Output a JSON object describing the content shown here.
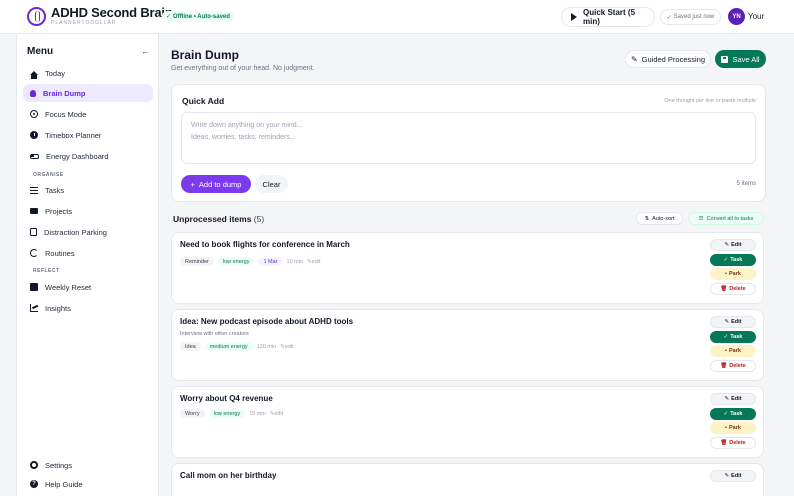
{
  "header": {
    "brand_title": "ADHD Second Brain",
    "brand_subtitle": "PLANNERTODOLLAR",
    "offline_badge": "Offline • Auto-saved",
    "quick_start_label": "Quick Start (5 min)",
    "saved_status": "Saved just now",
    "avatar_initials": "YN",
    "user_label": "Your"
  },
  "sidebar": {
    "title": "Menu",
    "items": [
      {
        "label": "Today",
        "icon": "home-icon"
      },
      {
        "label": "Brain Dump",
        "icon": "lightbulb-icon",
        "active": true
      },
      {
        "label": "Focus Mode",
        "icon": "target-icon"
      },
      {
        "label": "Timebox Planner",
        "icon": "clock-icon"
      },
      {
        "label": "Energy Dashboard",
        "icon": "battery-icon"
      }
    ],
    "section_organise": "ORGANISE",
    "organise_items": [
      {
        "label": "Tasks",
        "icon": "list-icon"
      },
      {
        "label": "Projects",
        "icon": "folder-icon"
      },
      {
        "label": "Distraction Parking",
        "icon": "page-icon"
      },
      {
        "label": "Routines",
        "icon": "cycle-icon"
      }
    ],
    "section_reflect": "REFLECT",
    "reflect_items": [
      {
        "label": "Weekly Reset",
        "icon": "calendar-icon"
      },
      {
        "label": "Insights",
        "icon": "chart-icon"
      }
    ],
    "footer_items": [
      {
        "label": "Settings",
        "icon": "gear-icon"
      },
      {
        "label": "Help Guide",
        "icon": "help-icon"
      }
    ]
  },
  "page": {
    "title": "Brain Dump",
    "subtitle": "Get everything out of your head. No judgment.",
    "guided_label": "Guided Processing",
    "save_all_label": "Save All"
  },
  "quick_add": {
    "title": "Quick Add",
    "hint": "One thought per line or paste multiple",
    "placeholder": "Write down anything on your mind...\nIdeas, worries, tasks, reminders...",
    "add_label": "Add to dump",
    "clear_label": "Clear",
    "count": "5 items"
  },
  "unprocessed": {
    "title": "Unprocessed items",
    "count": "(5)",
    "auto_sort_label": "Auto-sort",
    "convert_label": "Convert all to tasks",
    "actions": {
      "edit": "Edit",
      "task": "Task",
      "park": "Park",
      "delete": "Delete"
    },
    "items": [
      {
        "title": "Need to book flights for conference in March",
        "desc": "",
        "chips": [
          "Reminder",
          "low energy",
          "1 Mar"
        ],
        "time": "10 min",
        "edit": "edit"
      },
      {
        "title": "Idea: New podcast episode about ADHD tools",
        "desc": "Interview with other creators",
        "chips": [
          "Idea",
          "medium energy"
        ],
        "time": "120 min",
        "edit": "edit"
      },
      {
        "title": "Worry about Q4 revenue",
        "desc": "",
        "chips": [
          "Worry",
          "low energy"
        ],
        "time": "15 min",
        "edit": "edit"
      },
      {
        "title": "Call mom on her birthday",
        "desc": "",
        "chips": [],
        "time": "",
        "edit": ""
      }
    ]
  }
}
